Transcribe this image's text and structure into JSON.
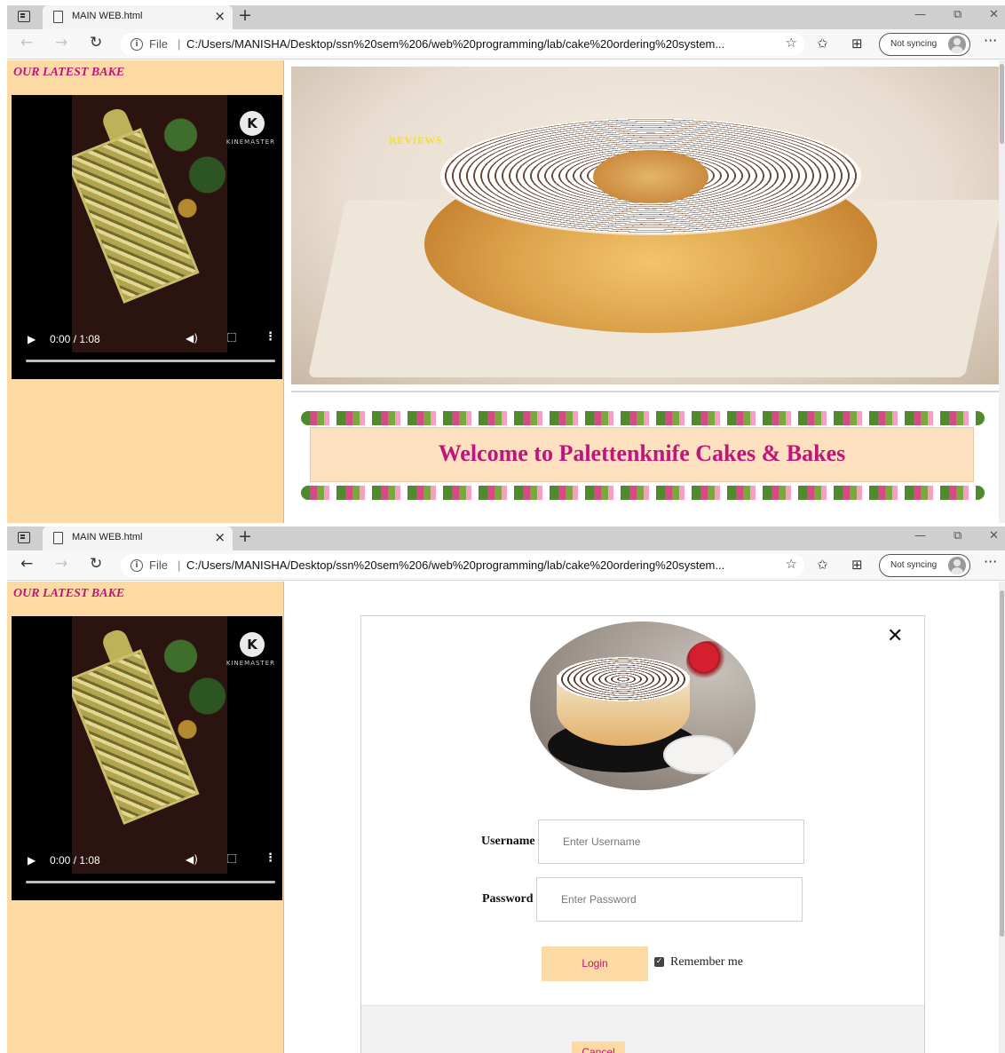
{
  "browser": {
    "tab_title": "MAIN WEB.html",
    "tab_close": "×",
    "new_tab": "+",
    "win_min": "—",
    "win_restore": "⧉",
    "win_close": "✕",
    "nav_back": "←",
    "nav_forward": "→",
    "nav_refresh": "↻",
    "info_symbol": "i",
    "file_label": "File",
    "url_separator": "|",
    "url": "C:/Users/MANISHA/Desktop/ssn%20sem%206/web%20programming/lab/cake%20ordering%20system...",
    "fav_icon": "☆",
    "favorites_icon": "✩",
    "collections_icon": "⊞",
    "sync_label": "Not syncing",
    "more_icon": "···"
  },
  "sidebar": {
    "heading": "OUR LATEST BAKE",
    "video": {
      "time": "0:00 / 1:08",
      "play_icon": "▶",
      "volume_icon": "◀)",
      "menu_icon": "⋮",
      "watermark_logo": "K",
      "watermark_text": "KINEMASTER"
    }
  },
  "home": {
    "reviews_link": "REVIEWS",
    "welcome": "Welcome to Palettenknife Cakes & Bakes"
  },
  "login": {
    "close_icon": "✕",
    "username_label": "Username",
    "username_placeholder": "Enter Username",
    "password_label": "Password",
    "password_placeholder": "Enter Password",
    "login_button": "Login",
    "remember_checked": true,
    "remember_check_glyph": "✓",
    "remember_label": "Remember me",
    "cancel_button": "Cancel"
  },
  "colors": {
    "accent": "#c0167a",
    "sidebar_bg": "#fdd9a3",
    "reviews": "#f4df2a"
  }
}
